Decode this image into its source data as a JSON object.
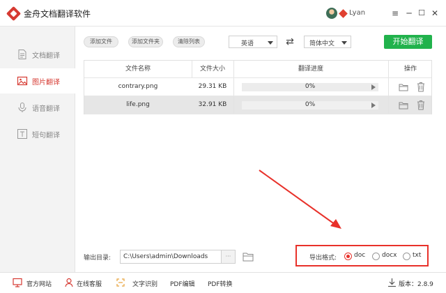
{
  "app": {
    "title": "金舟文档翻译软件",
    "user_name": "Lyan",
    "minimize": "─",
    "maximize": "☐",
    "close": "✕",
    "menu": "≡"
  },
  "sidebar": {
    "items": [
      {
        "label": "文档翻译",
        "icon": "document-icon",
        "active": false
      },
      {
        "label": "图片翻译",
        "icon": "image-icon",
        "active": true
      },
      {
        "label": "语音翻译",
        "icon": "microphone-icon",
        "active": false
      },
      {
        "label": "短句翻译",
        "icon": "text-icon",
        "active": false
      }
    ]
  },
  "toolbar": {
    "add_file": "添加文件",
    "add_folder": "添加文件夹",
    "clear_list": "清除列表",
    "source_lang": "英语",
    "target_lang": "简体中文",
    "swap": "⇄",
    "start": "开始翻译"
  },
  "table": {
    "headers": [
      "文件名称",
      "文件大小",
      "翻译进度",
      "操作"
    ],
    "rows": [
      {
        "name": "contrary.png",
        "size": "29.31 KB",
        "progress": "0%",
        "progress_value": 0,
        "selected": false
      },
      {
        "name": "life.png",
        "size": "32.91 KB",
        "progress": "0%",
        "progress_value": 0,
        "selected": true
      }
    ]
  },
  "output": {
    "label": "输出目录:",
    "path": "C:\\Users\\admin\\Downloads",
    "browse": "···"
  },
  "export": {
    "label": "导出格式:",
    "options": [
      {
        "label": "doc",
        "checked": true
      },
      {
        "label": "docx",
        "checked": false
      },
      {
        "label": "txt",
        "checked": false
      }
    ]
  },
  "footer": {
    "items": [
      "官方网站",
      "在线客服",
      "文字识别",
      "PDF编辑",
      "PDF转换"
    ],
    "version": "版本：2.8.9"
  },
  "colors": {
    "accent": "#d63a32",
    "start_button": "#21b24c",
    "highlight_box": "#e8312a"
  }
}
